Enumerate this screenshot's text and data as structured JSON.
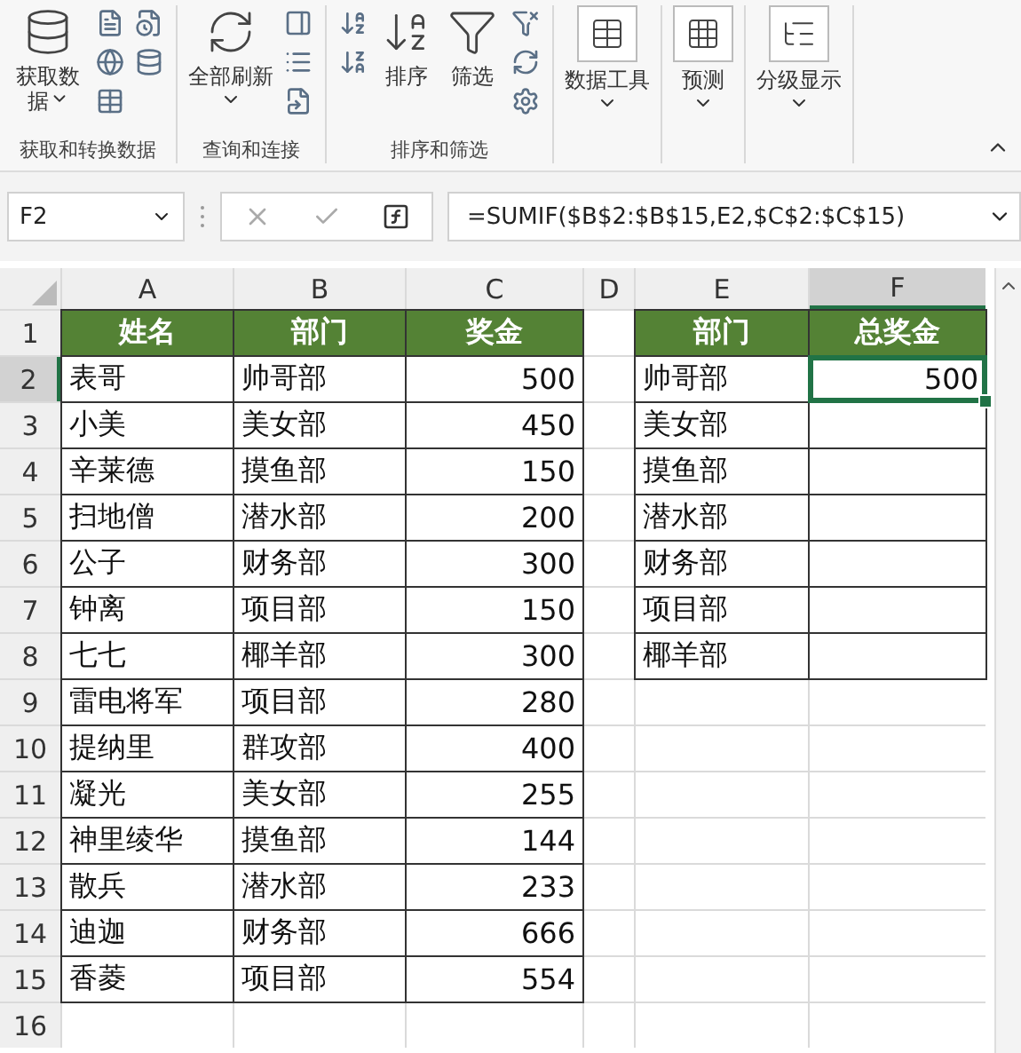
{
  "ribbon": {
    "groups": [
      {
        "label": "获取和转换数据",
        "buttons": [
          {
            "label": "获取数据",
            "dropdown": true
          }
        ]
      },
      {
        "label": "查询和连接",
        "buttons": [
          {
            "label": "全部刷新",
            "dropdown": true
          }
        ]
      },
      {
        "label": "排序和筛选",
        "buttons": [
          {
            "label": "排序",
            "dropdown": false
          },
          {
            "label": "筛选",
            "dropdown": false
          }
        ]
      },
      {
        "buttons": [
          {
            "label": "数据工具",
            "dropdown": true
          }
        ]
      },
      {
        "buttons": [
          {
            "label": "预测",
            "dropdown": true
          }
        ]
      },
      {
        "buttons": [
          {
            "label": "分级显示",
            "dropdown": true
          }
        ]
      }
    ]
  },
  "formula_bar": {
    "name_box": "F2",
    "formula": "=SUMIF($B$2:$B$15,E2,$C$2:$C$15)"
  },
  "sheet": {
    "columns": [
      "A",
      "B",
      "C",
      "D",
      "E",
      "F"
    ],
    "rows": [
      {
        "label": "1",
        "cells": [
          {
            "text": "姓名",
            "kind": "head",
            "selected": false
          },
          {
            "text": "部门",
            "kind": "head",
            "selected": false
          },
          {
            "text": "奖金",
            "kind": "head",
            "selected": false
          },
          {
            "kind": "blank",
            "selected": false
          },
          {
            "text": "部门",
            "kind": "head",
            "selected": false
          },
          {
            "text": "总奖金",
            "kind": "head",
            "selected": false
          }
        ]
      },
      {
        "label": "2",
        "cells": [
          {
            "text": "表哥",
            "kind": "text",
            "selected": false
          },
          {
            "text": "帅哥部",
            "kind": "text",
            "selected": false
          },
          {
            "text": "500",
            "kind": "number",
            "selected": false
          },
          {
            "kind": "blank",
            "selected": false
          },
          {
            "text": "帅哥部",
            "kind": "text",
            "selected": false
          },
          {
            "text": "500",
            "kind": "number",
            "selected": true
          }
        ]
      },
      {
        "label": "3",
        "cells": [
          {
            "text": "小美",
            "kind": "text",
            "selected": false
          },
          {
            "text": "美女部",
            "kind": "text",
            "selected": false
          },
          {
            "text": "450",
            "kind": "number",
            "selected": false
          },
          {
            "kind": "blank",
            "selected": false
          },
          {
            "text": "美女部",
            "kind": "text",
            "selected": false
          },
          {
            "kind": "box",
            "selected": false
          }
        ]
      },
      {
        "label": "4",
        "cells": [
          {
            "text": "辛莱德",
            "kind": "text",
            "selected": false
          },
          {
            "text": "摸鱼部",
            "kind": "text",
            "selected": false
          },
          {
            "text": "150",
            "kind": "number",
            "selected": false
          },
          {
            "kind": "blank",
            "selected": false
          },
          {
            "text": "摸鱼部",
            "kind": "text",
            "selected": false
          },
          {
            "kind": "box",
            "selected": false
          }
        ]
      },
      {
        "label": "5",
        "cells": [
          {
            "text": "扫地僧",
            "kind": "text",
            "selected": false
          },
          {
            "text": "潜水部",
            "kind": "text",
            "selected": false
          },
          {
            "text": "200",
            "kind": "number",
            "selected": false
          },
          {
            "kind": "blank",
            "selected": false
          },
          {
            "text": "潜水部",
            "kind": "text",
            "selected": false
          },
          {
            "kind": "box",
            "selected": false
          }
        ]
      },
      {
        "label": "6",
        "cells": [
          {
            "text": "公子",
            "kind": "text",
            "selected": false
          },
          {
            "text": "财务部",
            "kind": "text",
            "selected": false
          },
          {
            "text": "300",
            "kind": "number",
            "selected": false
          },
          {
            "kind": "blank",
            "selected": false
          },
          {
            "text": "财务部",
            "kind": "text",
            "selected": false
          },
          {
            "kind": "box",
            "selected": false
          }
        ]
      },
      {
        "label": "7",
        "cells": [
          {
            "text": "钟离",
            "kind": "text",
            "selected": false
          },
          {
            "text": "项目部",
            "kind": "text",
            "selected": false
          },
          {
            "text": "150",
            "kind": "number",
            "selected": false
          },
          {
            "kind": "blank",
            "selected": false
          },
          {
            "text": "项目部",
            "kind": "text",
            "selected": false
          },
          {
            "kind": "box",
            "selected": false
          }
        ]
      },
      {
        "label": "8",
        "cells": [
          {
            "text": "七七",
            "kind": "text",
            "selected": false
          },
          {
            "text": "椰羊部",
            "kind": "text",
            "selected": false
          },
          {
            "text": "300",
            "kind": "number",
            "selected": false
          },
          {
            "kind": "blank",
            "selected": false
          },
          {
            "text": "椰羊部",
            "kind": "text",
            "selected": false
          },
          {
            "kind": "box",
            "selected": false
          }
        ]
      },
      {
        "label": "9",
        "cells": [
          {
            "text": "雷电将军",
            "kind": "text",
            "selected": false
          },
          {
            "text": "项目部",
            "kind": "text",
            "selected": false
          },
          {
            "text": "280",
            "kind": "number",
            "selected": false
          },
          {
            "kind": "blank",
            "selected": false
          },
          {
            "kind": "blank",
            "selected": false
          },
          {
            "kind": "blank",
            "selected": false
          }
        ]
      },
      {
        "label": "10",
        "cells": [
          {
            "text": "提纳里",
            "kind": "text",
            "selected": false
          },
          {
            "text": "群攻部",
            "kind": "text",
            "selected": false
          },
          {
            "text": "400",
            "kind": "number",
            "selected": false
          },
          {
            "kind": "blank",
            "selected": false
          },
          {
            "kind": "blank",
            "selected": false
          },
          {
            "kind": "blank",
            "selected": false
          }
        ]
      },
      {
        "label": "11",
        "cells": [
          {
            "text": "凝光",
            "kind": "text",
            "selected": false
          },
          {
            "text": "美女部",
            "kind": "text",
            "selected": false
          },
          {
            "text": "255",
            "kind": "number",
            "selected": false
          },
          {
            "kind": "blank",
            "selected": false
          },
          {
            "kind": "blank",
            "selected": false
          },
          {
            "kind": "blank",
            "selected": false
          }
        ]
      },
      {
        "label": "12",
        "cells": [
          {
            "text": "神里绫华",
            "kind": "text",
            "selected": false
          },
          {
            "text": "摸鱼部",
            "kind": "text",
            "selected": false
          },
          {
            "text": "144",
            "kind": "number",
            "selected": false
          },
          {
            "kind": "blank",
            "selected": false
          },
          {
            "kind": "blank",
            "selected": false
          },
          {
            "kind": "blank",
            "selected": false
          }
        ]
      },
      {
        "label": "13",
        "cells": [
          {
            "text": "散兵",
            "kind": "text",
            "selected": false
          },
          {
            "text": "潜水部",
            "kind": "text",
            "selected": false
          },
          {
            "text": "233",
            "kind": "number",
            "selected": false
          },
          {
            "kind": "blank",
            "selected": false
          },
          {
            "kind": "blank",
            "selected": false
          },
          {
            "kind": "blank",
            "selected": false
          }
        ]
      },
      {
        "label": "14",
        "cells": [
          {
            "text": "迪迦",
            "kind": "text",
            "selected": false
          },
          {
            "text": "财务部",
            "kind": "text",
            "selected": false
          },
          {
            "text": "666",
            "kind": "number",
            "selected": false
          },
          {
            "kind": "blank",
            "selected": false
          },
          {
            "kind": "blank",
            "selected": false
          },
          {
            "kind": "blank",
            "selected": false
          }
        ]
      },
      {
        "label": "15",
        "cells": [
          {
            "text": "香菱",
            "kind": "text",
            "selected": false
          },
          {
            "text": "项目部",
            "kind": "text",
            "selected": false
          },
          {
            "text": "554",
            "kind": "number",
            "selected": false
          },
          {
            "kind": "blank",
            "selected": false
          },
          {
            "kind": "blank",
            "selected": false
          },
          {
            "kind": "blank",
            "selected": false
          }
        ]
      },
      {
        "label": "16",
        "cells": [
          {
            "kind": "blank",
            "selected": false
          },
          {
            "kind": "blank",
            "selected": false
          },
          {
            "kind": "blank",
            "selected": false
          },
          {
            "kind": "blank",
            "selected": false
          },
          {
            "kind": "blank",
            "selected": false
          },
          {
            "kind": "blank",
            "selected": false
          }
        ]
      }
    ]
  }
}
